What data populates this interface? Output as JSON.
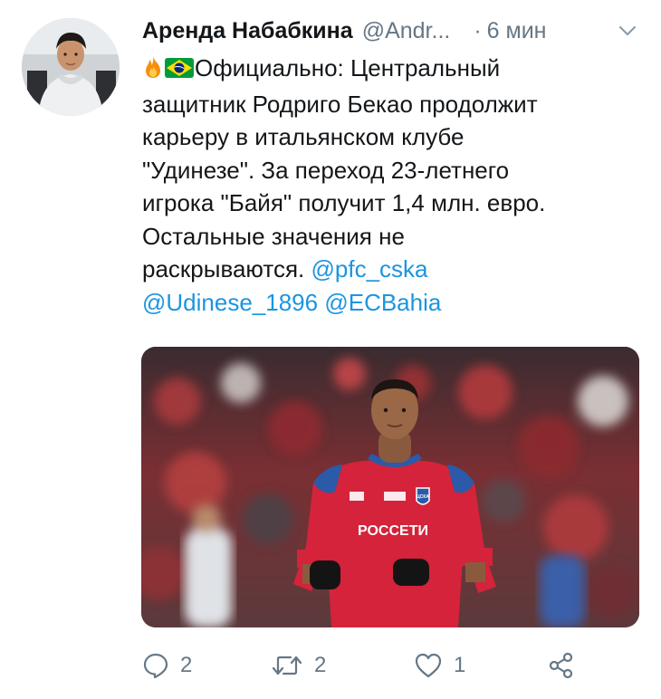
{
  "tweet": {
    "author_name": "Аренда Набабкина",
    "author_handle": "@Andr...",
    "separator": "·",
    "time_ago": "6 мин",
    "text_lines": [
      "Официально: Центральный",
      "защитник Родриго Бекао продолжит",
      "карьеру в итальянском клубе",
      "\"Удинезе\". За переход 23-летнего",
      "игрока \"Байя\" получит 1,4 млн. евро.",
      "Остальные значения не",
      "раскрываются. "
    ],
    "mentions": [
      "@pfc_cska",
      "@Udinese_1896",
      "@ECBahia"
    ],
    "jersey_sponsor_text": "РОССЕТИ",
    "jersey_badge_text": "ЦСКА"
  },
  "actions": {
    "reply_count": "2",
    "retweet_count": "2",
    "like_count": "1"
  },
  "icons": {
    "fire": "fire-icon",
    "flag": "brazil-flag-icon",
    "chevron": "chevron-down-icon",
    "reply": "reply-icon",
    "retweet": "retweet-icon",
    "like": "heart-icon",
    "share": "share-icon"
  },
  "colors": {
    "link": "#1b95e0",
    "muted": "#657786",
    "text": "#14171a",
    "jersey_red": "#d4233a",
    "jersey_blue": "#2b5aa8"
  }
}
